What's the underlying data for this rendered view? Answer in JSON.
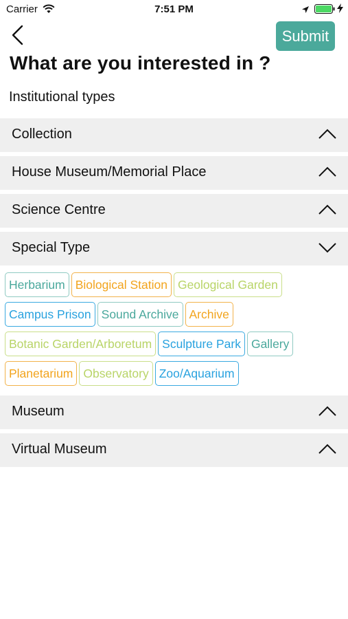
{
  "status_bar": {
    "carrier": "Carrier",
    "time": "7:51 PM"
  },
  "header": {
    "submit_label": "Submit",
    "title": "What are you interested in ?",
    "subtitle": "Institutional types"
  },
  "colors": {
    "accent": "#4ba99b",
    "section_bg": "#efefef",
    "tag_teal": "#4aa89c",
    "tag_orange": "#f2a41d",
    "tag_lime": "#b8d467",
    "tag_blue": "#29a2df"
  },
  "sections": [
    {
      "label": "Collection",
      "expanded": false,
      "icon": "chevron-up-icon"
    },
    {
      "label": "House Museum/Memorial Place",
      "expanded": false,
      "icon": "chevron-up-icon"
    },
    {
      "label": "Science Centre",
      "expanded": false,
      "icon": "chevron-up-icon"
    },
    {
      "label": "Special Type",
      "expanded": true,
      "icon": "chevron-down-icon",
      "tags": [
        {
          "label": "Herbarium",
          "color": "teal"
        },
        {
          "label": "Biological Station",
          "color": "orange"
        },
        {
          "label": "Geological Garden",
          "color": "lime"
        },
        {
          "label": "Campus Prison",
          "color": "blue"
        },
        {
          "label": "Sound Archive",
          "color": "teal"
        },
        {
          "label": "Archive",
          "color": "orange"
        },
        {
          "label": "Botanic Garden/Arboretum",
          "color": "lime"
        },
        {
          "label": "Sculpture Park",
          "color": "blue"
        },
        {
          "label": "Gallery",
          "color": "teal"
        },
        {
          "label": "Planetarium",
          "color": "orange"
        },
        {
          "label": "Observatory",
          "color": "lime"
        },
        {
          "label": "Zoo/Aquarium",
          "color": "blue"
        }
      ]
    },
    {
      "label": "Museum",
      "expanded": false,
      "icon": "chevron-up-icon"
    },
    {
      "label": "Virtual Museum",
      "expanded": false,
      "icon": "chevron-up-icon"
    }
  ]
}
